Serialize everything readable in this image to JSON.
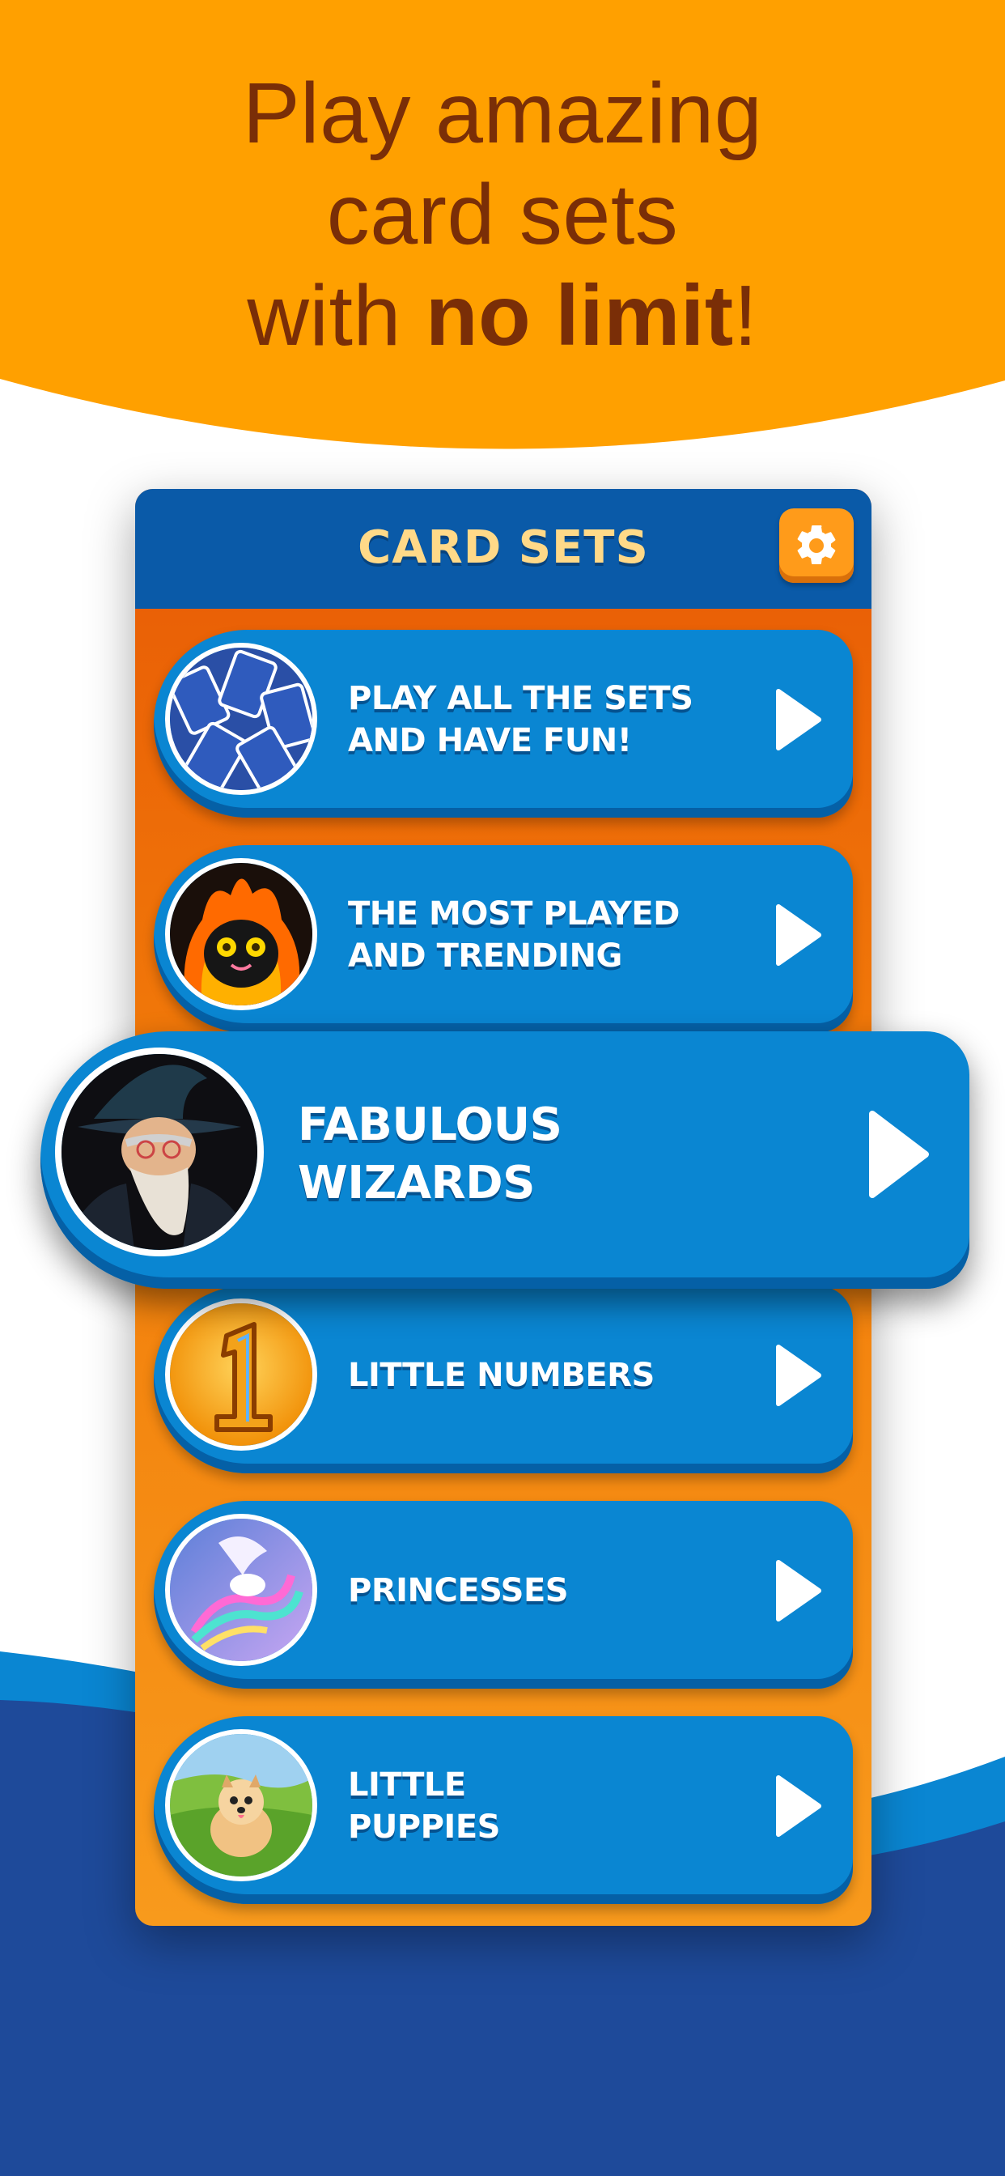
{
  "headline": {
    "line1": "Play amazing",
    "line2": "card sets",
    "line3_prefix": "with ",
    "line3_bold": "no limit",
    "line3_suffix": "!"
  },
  "panel": {
    "title": "CARD SETS",
    "settings_icon": "gear-icon"
  },
  "card_sets": [
    {
      "label": "PLAY ALL THE SETS\nAND HAVE FUN!",
      "thumb": "cards-pattern-icon"
    },
    {
      "label": "THE MOST PLAYED\nAND TRENDING",
      "thumb": "fire-creature-image"
    },
    {
      "label": "FABULOUS\nWIZARDS",
      "thumb": "wizard-image",
      "featured": true
    },
    {
      "label": "LITTLE NUMBERS",
      "thumb": "number-one-image"
    },
    {
      "label": "PRINCESSES",
      "thumb": "pegasus-princess-image"
    },
    {
      "label": "LITTLE\nPUPPIES",
      "thumb": "puppy-image"
    }
  ],
  "colors": {
    "orange": "#ff9f00",
    "headline_text": "#7a2e07",
    "panel_header": "#0a5aa8",
    "row_blue": "#0a86d2",
    "title_yellow": "#ffd988",
    "bottom_blue": "#1e4a9a"
  }
}
